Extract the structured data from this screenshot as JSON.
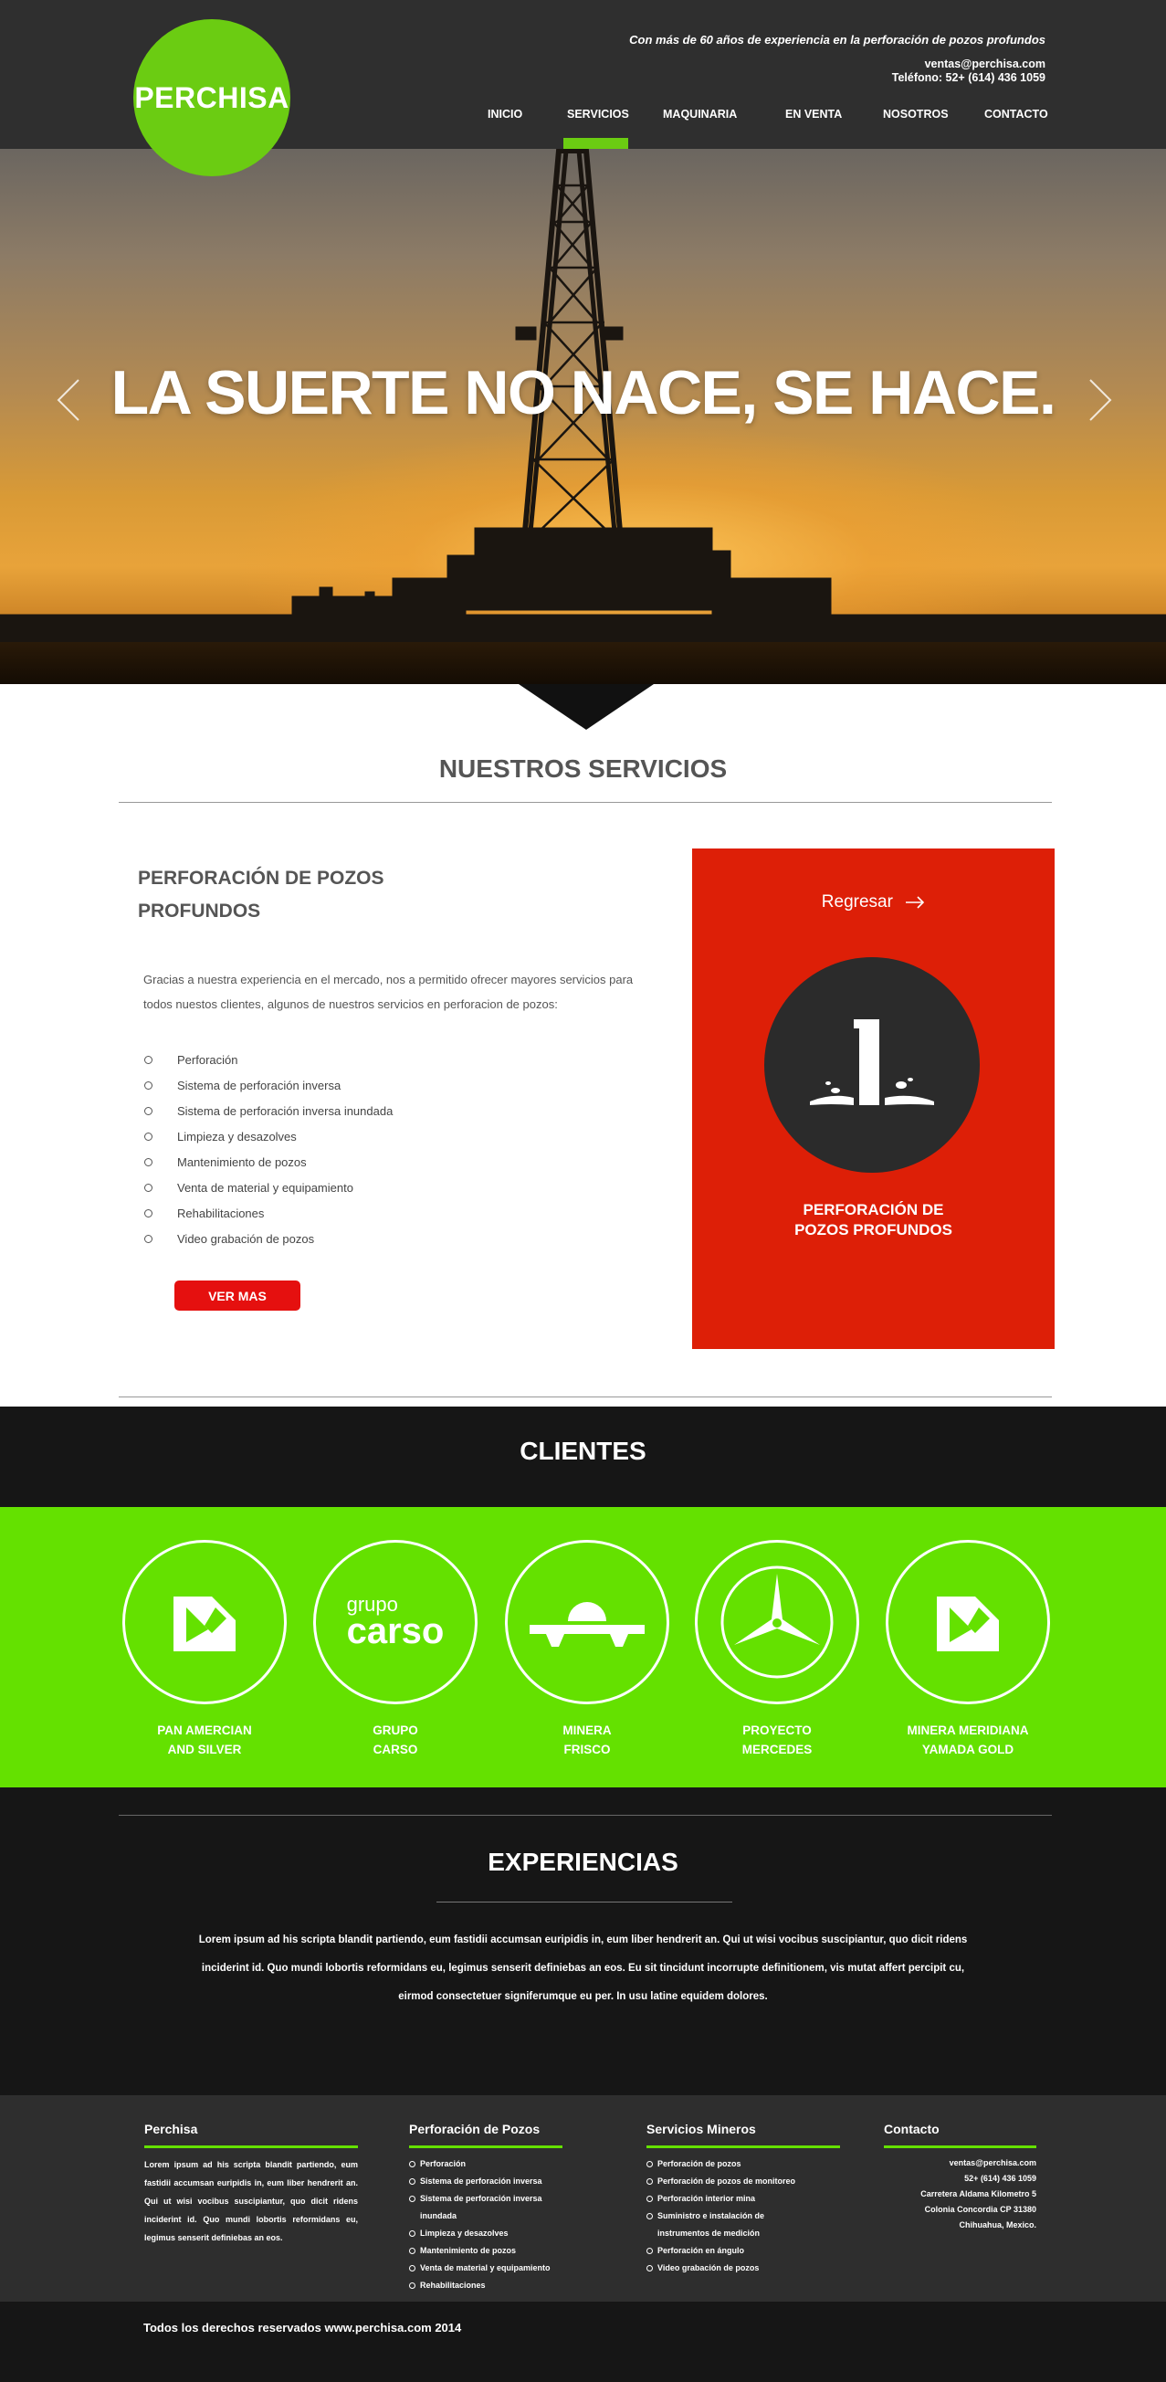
{
  "brand": {
    "logo_text": "PERCHISA",
    "accent": "#6bcc12"
  },
  "header": {
    "tagline": "Con más de  60 años de experiencia  en la perforación de pozos profundos",
    "email": "ventas@perchisa.com",
    "phone": "Teléfono: 52+ (614) 436 1059"
  },
  "nav": {
    "items": [
      {
        "label": "INICIO"
      },
      {
        "label": "SERVICIOS",
        "active": true
      },
      {
        "label": "MAQUINARIA"
      },
      {
        "label": "EN VENTA"
      },
      {
        "label": "NOSOTROS"
      },
      {
        "label": "CONTACTO"
      }
    ]
  },
  "hero": {
    "title": "LA SUERTE NO NACE, SE HACE."
  },
  "services": {
    "section_title": "NUESTROS SERVICIOS",
    "heading_line1": "PERFORACIÓN DE POZOS",
    "heading_line2": "PROFUNDOS",
    "description": "Gracias a nuestra experiencia en el mercado, nos a permitido ofrecer mayores servicios para todos nuestos clientes, algunos de nuestros servicios en perforacion de pozos:",
    "list": [
      "Perforación",
      "Sistema de perforación inversa",
      "Sistema de perforación inversa inundada",
      "Limpieza y desazolves",
      "Mantenimiento de pozos",
      "Venta de material y equipamiento",
      "Rehabilitaciones",
      "Video grabación de pozos"
    ],
    "button": "VER MAS",
    "card": {
      "back_label": "Regresar",
      "caption_line1": "PERFORACIÓN DE",
      "caption_line2": "POZOS PROFUNDOS",
      "color": "#dd1f07"
    }
  },
  "clients": {
    "section_title": "CLIENTES",
    "items": [
      {
        "line1": "PAN AMERCIAN",
        "line2": "AND SILVER",
        "icon": "pan-american-logo"
      },
      {
        "line1": "GRUPO",
        "line2": "CARSO",
        "icon": "grupo-carso-logo",
        "logo_small": "grupo",
        "logo_big": "carso"
      },
      {
        "line1": "MINERA",
        "line2": "FRISCO",
        "icon": "minera-frisco-logo"
      },
      {
        "line1": "PROYECTO",
        "line2": "MERCEDES",
        "icon": "mercedes-star-logo"
      },
      {
        "line1": "MINERA MERIDIANA",
        "line2": "YAMADA GOLD",
        "icon": "meridiana-logo"
      }
    ]
  },
  "experiences": {
    "section_title": "EXPERIENCIAS",
    "text": "Lorem ipsum ad his scripta blandit partiendo, eum fastidii accumsan euripidis in, eum liber hendrerit an. Qui ut wisi vocibus suscipiantur, quo dicit ridens inciderint id. Quo mundi lobortis reformidans eu, legimus senserit definiebas an eos. Eu sit tincidunt incorrupte definitionem, vis mutat affert percipit cu, eirmod consectetuer signiferumque eu per. In usu latine equidem dolores."
  },
  "footer": {
    "col1": {
      "title": "Perchisa",
      "text": "Lorem ipsum ad his scripta blandit partiendo, eum fastidii accumsan euripidis in, eum liber hendrerit an. Qui ut wisi vocibus suscipiantur, quo dicit ridens inciderint id. Quo mundi lobortis reformidans eu, legimus senserit definiebas an eos."
    },
    "col2": {
      "title": "Perforación de Pozos",
      "items": [
        "Perforación",
        "Sistema de perforación inversa",
        "Sistema de perforación inversa inundada",
        "Limpieza y desazolves",
        "Mantenimiento de pozos",
        "Venta de material y equipamiento",
        "Rehabilitaciones"
      ]
    },
    "col3": {
      "title": "Servicios Mineros",
      "items": [
        "Perforación de pozos",
        "Perforación de pozos de monitoreo",
        "Perforación interior mina",
        "Suministro e instalación de instrumentos de medición",
        "Perforación en ángulo",
        "Video grabación de pozos"
      ]
    },
    "col4": {
      "title": "Contacto",
      "lines": [
        "ventas@perchisa.com",
        "52+ (614) 436 1059",
        "Carretera Aldama Kilometro 5",
        "Colonia Concordia CP 31380",
        "Chihuahua, Mexico."
      ]
    },
    "copyright": "Todos los derechos reservados www.perchisa.com 2014"
  }
}
